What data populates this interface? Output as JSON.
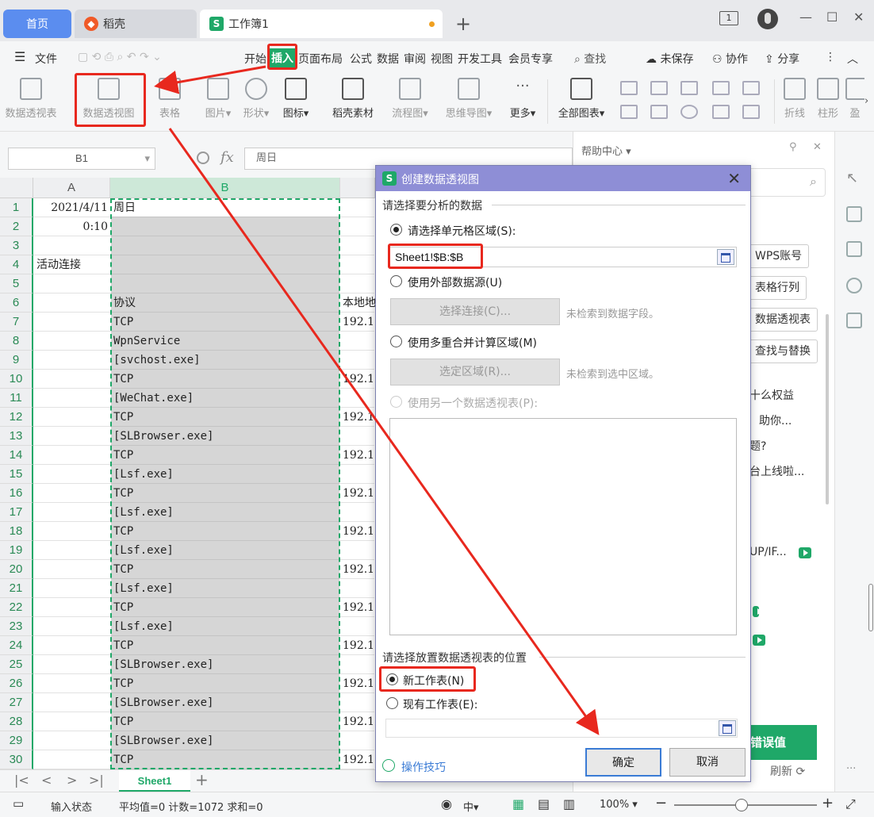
{
  "tabs": {
    "home": "首页",
    "daoke": "稻壳",
    "workbook": "工作簿1",
    "daoke_icon": "daoke-logo-icon",
    "workbook_icon_letter": "S"
  },
  "window": {
    "badge": "1"
  },
  "menu": {
    "file": "文件",
    "items": [
      "开始",
      "插入",
      "页面布局",
      "公式",
      "数据",
      "审阅",
      "视图",
      "开发工具",
      "会员专享"
    ],
    "active": "插入",
    "search": "查找",
    "unsaved": "未保存",
    "collab": "协作",
    "share": "分享"
  },
  "ribbon": {
    "pivot_table": "数据透视表",
    "pivot_chart": "数据透视图",
    "table": "表格",
    "picture": "图片",
    "shape": "形状",
    "icon": "图标",
    "daoke_material": "稻壳素材",
    "flowchart": "流程图",
    "mindmap": "思维导图",
    "more": "更多",
    "all_charts": "全部图表",
    "line": "折线",
    "bar": "柱形",
    "win": "盈"
  },
  "formula": {
    "cell_ref": "B1",
    "fx": "fx",
    "content": "周日"
  },
  "grid": {
    "col_a": "A",
    "col_b": "B",
    "row_numbers": [
      "1",
      "2",
      "3",
      "4",
      "5",
      "6",
      "7",
      "8",
      "9",
      "10",
      "11",
      "12",
      "13",
      "14",
      "15",
      "16",
      "17",
      "18",
      "19",
      "20",
      "21",
      "22",
      "23",
      "24",
      "25",
      "26",
      "27",
      "28",
      "29",
      "30"
    ],
    "col_a_values": [
      "2021/4/11",
      "0:10",
      "",
      "活动连接",
      "",
      "",
      "",
      "",
      "",
      "",
      "",
      "",
      "",
      "",
      "",
      "",
      "",
      "",
      "",
      "",
      "",
      "",
      "",
      "",
      "",
      "",
      "",
      "",
      "",
      ""
    ],
    "col_b_values": [
      "周日",
      "",
      "",
      "",
      "",
      "协议",
      "TCP",
      "WpnService",
      "[svchost.exe]",
      "TCP",
      "[WeChat.exe]",
      "TCP",
      "[SLBrowser.exe]",
      "TCP",
      "[Lsf.exe]",
      "TCP",
      "[Lsf.exe]",
      "TCP",
      "[Lsf.exe]",
      "TCP",
      "[Lsf.exe]",
      "TCP",
      "[Lsf.exe]",
      "TCP",
      "[SLBrowser.exe]",
      "TCP",
      "[SLBrowser.exe]",
      "TCP",
      "[SLBrowser.exe]",
      "TCP"
    ],
    "col_c_values": [
      "",
      "",
      "",
      "",
      "",
      "本地地",
      "192.1",
      "",
      "",
      "192.1",
      "",
      "192.1",
      "",
      "192.1",
      "",
      "192.1",
      "",
      "192.1",
      "",
      "192.1",
      "",
      "192.1",
      "",
      "192.1",
      "",
      "192.1",
      "",
      "192.1",
      "",
      "192.1"
    ]
  },
  "sheets": {
    "active": "Sheet1",
    "add": "+"
  },
  "status": {
    "input_state": "输入状态",
    "summary": "平均值=0  计数=1072  求和=0",
    "ime": "中",
    "zoom": "100%"
  },
  "help": {
    "title": "帮助中心",
    "chips": [
      "WPS账号",
      "表格行列",
      "数据透视表",
      "查找与替换"
    ],
    "lines": [
      "十么权益",
      "助你...",
      "题?",
      "台上线啦..."
    ],
    "video": "UP/IF...",
    "cta": "错误值",
    "refresh": "刷新"
  },
  "dialog": {
    "title": "创建数据透视图",
    "section1": "请选择要分析的数据",
    "opt_range": "请选择单元格区域(S):",
    "range_value": "Sheet1!$B:$B",
    "opt_external": "使用外部数据源(U)",
    "choose_conn": "选择连接(C)...",
    "no_field": "未检索到数据字段。",
    "opt_multi": "使用多重合并计算区域(M)",
    "select_area": "选定区域(R)...",
    "no_area": "未检索到选中区域。",
    "opt_other": "使用另一个数据透视表(P):",
    "section2": "请选择放置数据透视表的位置",
    "opt_new": "新工作表(N)",
    "opt_existing": "现有工作表(E):",
    "existing_value": "",
    "tips": "操作技巧",
    "ok": "确定",
    "cancel": "取消"
  },
  "colors": {
    "accent_green": "#1fa868",
    "annotation_red": "#e8281e",
    "dialog_title": "#8e8ed6",
    "home_tab": "#5b8def"
  }
}
